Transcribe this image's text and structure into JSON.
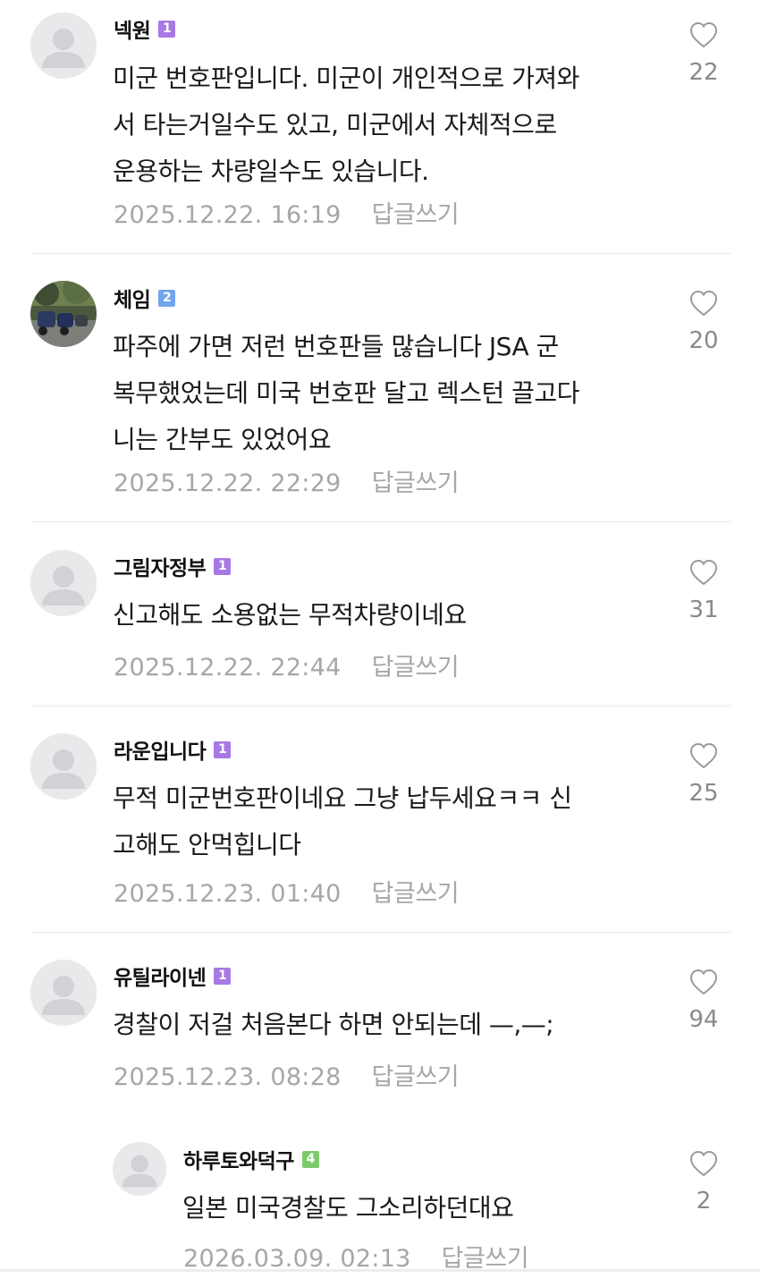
{
  "comments": [
    {
      "nickname": "넥원",
      "badge": "1",
      "badge_color": "#a879e4",
      "lines": [
        "미군 번호판입니다. 미군이 개인적으로 가져와",
        "서 타는거일수도 있고, 미군에서 자체적으로",
        "운용하는 차량일수도 있습니다."
      ],
      "date": "2025.12.22. 16:19",
      "reply_label": "답글쓰기",
      "likes": "22",
      "avatar": "default-avatar"
    },
    {
      "nickname": "체임",
      "badge": "2",
      "badge_color": "#72a5ec",
      "lines": [
        "파주에 가면 저런 번호판들 많습니다 JSA 군",
        "복무했었는데 미국 번호판 달고 렉스턴 끌고다",
        "니는 간부도 있었어요"
      ],
      "date": "2025.12.22. 22:29",
      "reply_label": "답글쓰기",
      "likes": "20",
      "avatar": "photo-avatar"
    },
    {
      "nickname": "그림자정부",
      "badge": "1",
      "badge_color": "#a879e4",
      "lines": [
        "신고해도 소용없는 무적차량이네요"
      ],
      "date": "2025.12.22. 22:44",
      "reply_label": "답글쓰기",
      "likes": "31",
      "avatar": "default-avatar"
    },
    {
      "nickname": "라운입니다",
      "badge": "1",
      "badge_color": "#a879e4",
      "lines": [
        "무적 미군번호판이네요 그냥 납두세요ㅋㅋ 신",
        "고해도 안먹힙니다"
      ],
      "date": "2025.12.23. 01:40",
      "reply_label": "답글쓰기",
      "likes": "25",
      "avatar": "default-avatar"
    },
    {
      "nickname": "유틸라이넨",
      "badge": "1",
      "badge_color": "#a879e4",
      "lines": [
        "경찰이 저걸 처음본다 하면 안되는데 —,—;"
      ],
      "date": "2025.12.23. 08:28",
      "reply_label": "답글쓰기",
      "likes": "94",
      "avatar": "default-avatar"
    },
    {
      "nickname": "하루토와덕구",
      "badge": "4",
      "badge_color": "#7ccb6b",
      "lines": [
        "일본 미국경찰도 그소리하던대요"
      ],
      "date": "2026.03.09. 02:13",
      "reply_label": "답글쓰기",
      "likes": "2",
      "avatar": "default-avatar"
    }
  ],
  "icons": {
    "like": "heart-outline-icon",
    "avatar": "person-silhouette-icon"
  }
}
